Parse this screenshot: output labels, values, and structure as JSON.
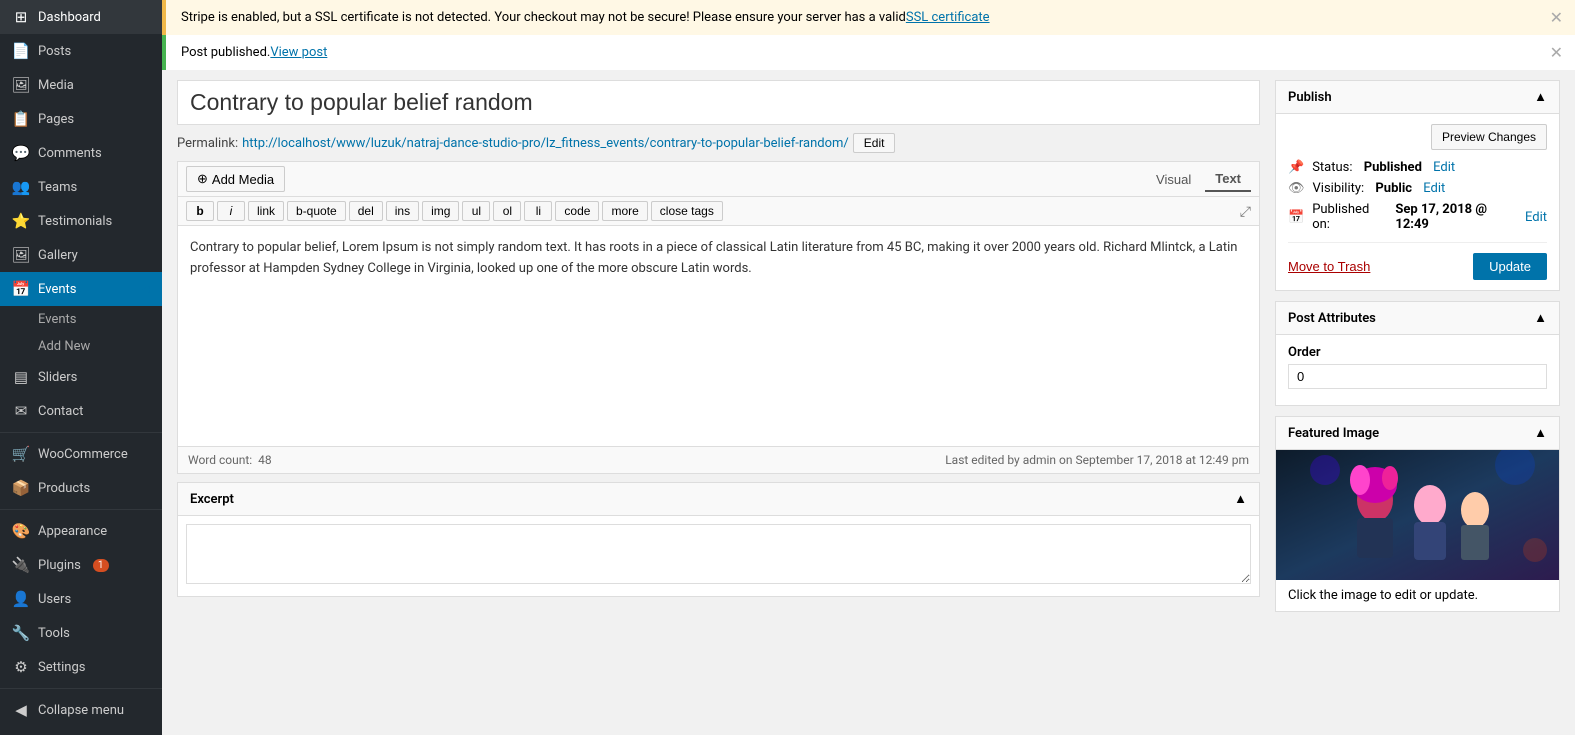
{
  "sidebar": {
    "items": [
      {
        "id": "dashboard",
        "label": "Dashboard",
        "icon": "⊞"
      },
      {
        "id": "posts",
        "label": "Posts",
        "icon": "📄"
      },
      {
        "id": "media",
        "label": "Media",
        "icon": "🖼"
      },
      {
        "id": "pages",
        "label": "Pages",
        "icon": "📋"
      },
      {
        "id": "comments",
        "label": "Comments",
        "icon": "💬"
      },
      {
        "id": "teams",
        "label": "Teams",
        "icon": "👥"
      },
      {
        "id": "testimonials",
        "label": "Testimonials",
        "icon": "⭐"
      },
      {
        "id": "gallery",
        "label": "Gallery",
        "icon": "🖼"
      },
      {
        "id": "events",
        "label": "Events",
        "icon": "📅",
        "active": true
      },
      {
        "id": "sliders",
        "label": "Sliders",
        "icon": "▤"
      },
      {
        "id": "contact",
        "label": "Contact",
        "icon": "✉"
      },
      {
        "id": "woocommerce",
        "label": "WooCommerce",
        "icon": "🛒"
      },
      {
        "id": "products",
        "label": "Products",
        "icon": "📦"
      },
      {
        "id": "appearance",
        "label": "Appearance",
        "icon": "🎨"
      },
      {
        "id": "plugins",
        "label": "Plugins",
        "icon": "🔌",
        "badge": "1"
      },
      {
        "id": "users",
        "label": "Users",
        "icon": "👤"
      },
      {
        "id": "tools",
        "label": "Tools",
        "icon": "🔧"
      },
      {
        "id": "settings",
        "label": "Settings",
        "icon": "⚙"
      }
    ],
    "events_sub": [
      {
        "label": "Events"
      },
      {
        "label": "Add New"
      }
    ],
    "collapse_label": "Collapse menu"
  },
  "notices": {
    "warning": {
      "text": "Stripe is enabled, but a SSL certificate is not detected. Your checkout may not be secure! Please ensure your server has a valid ",
      "link_text": "SSL certificate"
    },
    "success": {
      "text": "Post published. ",
      "link_text": "View post"
    }
  },
  "editor": {
    "post_title": "Contrary to popular belief random",
    "permalink_label": "Permalink:",
    "permalink_url": "http://localhost/www/luzuk/natraj-dance-studio-pro/lz_fitness_events/contrary-to-popular-belief-random/",
    "edit_btn": "Edit",
    "add_media_btn": "Add Media",
    "view_visual": "Visual",
    "view_text": "Text",
    "format_buttons": [
      "b",
      "i",
      "link",
      "b-quote",
      "del",
      "ins",
      "img",
      "ul",
      "ol",
      "li",
      "code",
      "more",
      "close tags"
    ],
    "content": "Contrary to popular belief, Lorem Ipsum is not simply random text. It has roots in a piece of classical Latin literature from 45 BC, making it over 2000 years old. Richard Mlintck, a Latin professor at Hampden Sydney College in Virginia, looked up one of the more obscure Latin words.",
    "word_count_label": "Word count:",
    "word_count": "48",
    "last_edited": "Last edited by admin on September 17, 2018 at 12:49 pm"
  },
  "excerpt": {
    "label": "Excerpt"
  },
  "publish_box": {
    "title": "Publish",
    "preview_btn": "Preview Changes",
    "status_label": "Status:",
    "status_value": "Published",
    "status_edit": "Edit",
    "visibility_label": "Visibility:",
    "visibility_value": "Public",
    "visibility_edit": "Edit",
    "published_label": "Published on:",
    "published_value": "Sep 17, 2018 @ 12:49",
    "published_edit": "Edit",
    "trash_btn": "Move to Trash",
    "update_btn": "Update"
  },
  "post_attributes": {
    "title": "Post Attributes",
    "order_label": "Order",
    "order_value": "0"
  },
  "featured_image": {
    "title": "Featured Image",
    "caption": "Click the image to edit or update."
  }
}
